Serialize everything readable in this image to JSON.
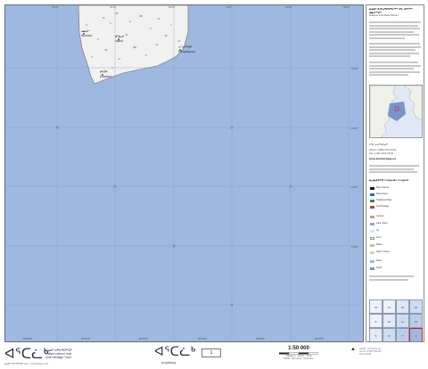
{
  "map": {
    "top_ticks": [
      "49°30'",
      "49°20'",
      "49°10'",
      "49°0'",
      "48°50'",
      "48°40'"
    ],
    "bottom_ticks": [
      "68°56'W",
      "68°52'W",
      "68°48'W",
      "68°44'W",
      "68°40'W",
      "68°36'W"
    ],
    "right_ticks": [
      "62°08'",
      "62°04'",
      "62°00'",
      "61°56'"
    ],
    "place_names": [
      {
        "syllabics": "ᓄᓇᐅᑉ",
        "roman": "Nunavut"
      },
      {
        "syllabics": "ᐃᖃᓗᒃ",
        "roman": "Iqaluit"
      },
      {
        "syllabics": "ᐸᖕᓂᖅᑐᖅ",
        "roman": "Pangniqtuuq"
      },
      {
        "syllabics": "ᑭᒻᒥᕈᑦ",
        "roman": "Kimmirut"
      }
    ],
    "water_color": "#9fb8e0",
    "land_color": "#f1f1ef"
  },
  "panel": {
    "heading_syl": "ᐃᓄᐃᑦ ᐊᓯᐅᔨᖃᑦᑕᕐᕕᖏᑦ ᐊᒻᒪ ᐊᑎᖏᑦ ᓄᓇᓕᖕᓂᑦ",
    "heading_en": "Nunavut Inuit Place Names",
    "contact_heading": "ᐅᖃᓪᓚᒍᓯᖃᕐᓗᑎᑦ",
    "phone_label": "Phone: 1-866-XXX-XXXX",
    "fax_label": "Fax: 1-867-XXX-XXXX",
    "web": "www.inuitheritage.ca",
    "legend_title": "ᓇᓗᓇᐃᔭᐅᑎ / Légende / Legend",
    "legend_items": [
      {
        "label": "Place Names",
        "color": "#1a1a1a"
      },
      {
        "label": "Place Name",
        "color": "#2b6cc4"
      },
      {
        "label": "Traditional Place",
        "color": "#2e8b57"
      },
      {
        "label": "Inuit Heritage",
        "color": "#a0522d"
      },
      {
        "label": "Contour",
        "color": "#c8a27a"
      },
      {
        "label": "Lake / River",
        "color": "#7fa8e0"
      },
      {
        "label": "Ice",
        "color": "#d8e8f0"
      },
      {
        "label": "Land",
        "color": "#f1f1ef"
      },
      {
        "label": "Marsh",
        "color": "#a9c9a3"
      },
      {
        "label": "Sand / Gravel",
        "color": "#e3d2a8"
      },
      {
        "label": "Water",
        "color": "#9fb8e0"
      },
      {
        "label": "Depth",
        "color": "#6f93cc"
      }
    ],
    "index_cells": [
      "13",
      "14",
      "15",
      "16",
      "9",
      "10",
      "11",
      "12",
      "5",
      "6",
      "7",
      "8"
    ],
    "selected_index": "1"
  },
  "footer": {
    "logo_syllabics": "ᐊᕐᑕᓛᒃ",
    "institute_syl": "ᐃᓄᐃᑦ ᐅᑭᐅᖅᑕᖅᑐᒥ",
    "institute_fr": "Institut culturel Inuit",
    "institute_en": "Inuit Heritage Trust",
    "footnote": "ᐃᓄᐃᑦ ᐅᑭᐅᖅᑕᖅᑐᒥ 2014 · Inuit Heritage Trust",
    "title_syllabics": "ᐊᕐᑕᓛᒃ",
    "title_roman": "Arqtallaaq",
    "sheet_number": "1",
    "scale": "1:50 000",
    "scale_sub_1": "ᐊᒃᑐᐊᓂᖓ · Échelle · Scale",
    "scale_sub_2": "ᑭᓛᒥᑕ · Kilomètres · Kilometres",
    "north_arrow": "▲",
    "notes": [
      "NAD83 · UTM Zone 19",
      "Source: NTDB 1:50 000",
      "Printed 2014"
    ]
  }
}
